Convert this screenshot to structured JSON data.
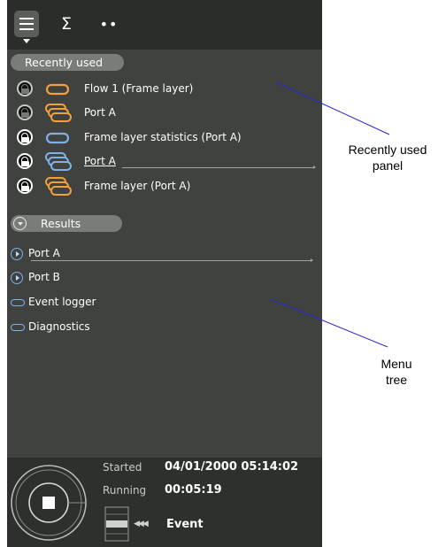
{
  "toolbar": {
    "menu_icon": "menu-icon",
    "sigma": "Σ",
    "dots": "••"
  },
  "recently_used": {
    "header": "Recently used",
    "items": [
      {
        "label": "Flow 1 (Frame layer)",
        "lock": "closed",
        "icon": "single-orange"
      },
      {
        "label": "Port A",
        "lock": "closed",
        "icon": "stack-orange"
      },
      {
        "label": "Frame layer statistics (Port A)",
        "lock": "open",
        "icon": "single-blue"
      },
      {
        "label": "Port A",
        "lock": "open",
        "icon": "stack-blue"
      },
      {
        "label": "Frame layer (Port A)",
        "lock": "open",
        "icon": "stack-orange"
      }
    ]
  },
  "results": {
    "header": "Results",
    "items": [
      {
        "label": "Port A",
        "type": "expand"
      },
      {
        "label": "Port B",
        "type": "expand"
      },
      {
        "label": "Event logger",
        "type": "pill"
      },
      {
        "label": "Diagnostics",
        "type": "pill"
      }
    ]
  },
  "status": {
    "started_label": "Started",
    "started_value": "04/01/2000 05:14:02",
    "running_label": "Running",
    "running_value": "00:05:19",
    "event_label": "Event"
  },
  "annotations": {
    "recently_used": [
      "Recently used",
      "panel"
    ],
    "menu_tree": [
      "Menu",
      "tree"
    ]
  },
  "colors": {
    "panel": "#3f423f",
    "toolbar": "#2b2d2b",
    "orange": "#f0a040",
    "blue": "#7fb0e6"
  }
}
